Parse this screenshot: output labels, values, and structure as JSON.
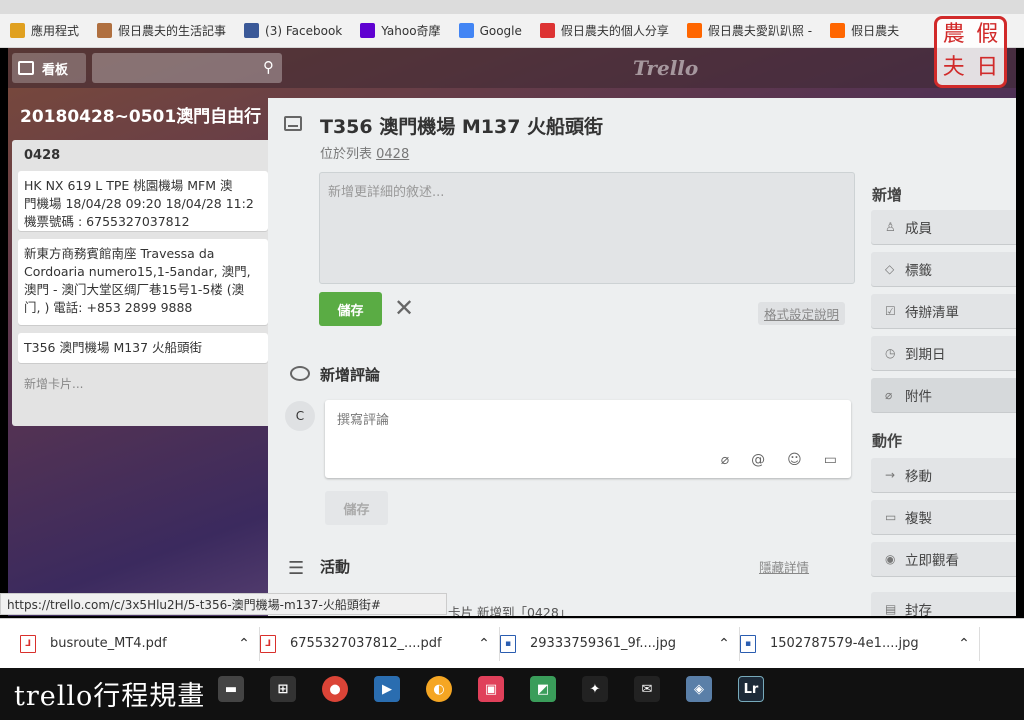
{
  "bookmarks": [
    {
      "label": "應用程式",
      "icon": "apps-grid-icon",
      "color": "#e0a020"
    },
    {
      "label": "假日農夫的生活記事",
      "icon": "farmer-avatar-icon",
      "color": "#b07040"
    },
    {
      "label": "(3) Facebook",
      "icon": "facebook-icon",
      "color": "#3b5998"
    },
    {
      "label": "Yahoo奇摩",
      "icon": "yahoo-icon",
      "color": "#5f01d1"
    },
    {
      "label": "Google",
      "icon": "google-icon",
      "color": "#4285f4"
    },
    {
      "label": "假日農夫的個人分享",
      "icon": "pin-icon",
      "color": "#d33"
    },
    {
      "label": "假日農夫愛趴趴照 - ",
      "icon": "blog-icon",
      "color": "#f60"
    },
    {
      "label": "假日農夫",
      "icon": "pixnet-icon",
      "color": "#f60"
    }
  ],
  "header": {
    "boards_label": "看板",
    "logo": "Trello"
  },
  "board": {
    "title": "20180428~0501澳門自由行"
  },
  "list": {
    "name": "0428",
    "cards": [
      "HK NX 619 L TPE 桃園機場 MFM 澳\n門機場 18/04/28 09:20 18/04/28 11:2\n機票號碼 : 6755327037812",
      "新東方商務賓館南座 Travessa da\nCordoaria numero15,1-5andar, 澳門,\n澳門 - 澳门大堂区绸厂巷15号1-5楼 (澳\n门, ) 電話: +853 2899 9888",
      "T356 澳門機場 M137 火船頭街"
    ],
    "add_card": "新增卡片..."
  },
  "card": {
    "title": "T356 澳門機場  M137 火船頭街",
    "in_list_prefix": "位於列表 ",
    "in_list_name": "0428",
    "desc_placeholder": "新增更詳細的敘述...",
    "save": "儲存",
    "close": "✕",
    "format_help": "格式設定說明",
    "comment_heading": "新增評論",
    "avatar_initial": "C",
    "comment_placeholder": "撰寫評論",
    "comment_save": "儲存",
    "activity_heading": "活動",
    "hide_details": "隱藏詳情",
    "activity_peek": "卡片 新增到「0428」"
  },
  "sidebar": {
    "add_heading": "新增",
    "add_items": [
      {
        "label": "成員",
        "icon": "member-icon"
      },
      {
        "label": "標籤",
        "icon": "label-icon"
      },
      {
        "label": "待辦清單",
        "icon": "checklist-icon"
      },
      {
        "label": "到期日",
        "icon": "clock-icon"
      },
      {
        "label": "附件",
        "icon": "attachment-icon"
      }
    ],
    "actions_heading": "動作",
    "action_items": [
      {
        "label": "移動",
        "icon": "arrow-right-icon"
      },
      {
        "label": "複製",
        "icon": "copy-icon"
      },
      {
        "label": "立即觀看",
        "icon": "eye-icon"
      },
      {
        "label": "封存",
        "icon": "archive-icon"
      }
    ]
  },
  "status_url": "https://trello.com/c/3x5Hlu2H/5-t356-澳門機場-m137-火船頭街#",
  "downloads": [
    {
      "name": "busroute_MT4.pdf",
      "type": "pdf"
    },
    {
      "name": "6755327037812_....pdf",
      "type": "pdf"
    },
    {
      "name": "29333759361_9f....jpg",
      "type": "img"
    },
    {
      "name": "1502787579-4e1....jpg",
      "type": "img"
    }
  ],
  "watermark": "trello行程規畫",
  "stamp": [
    "農",
    "假",
    "夫",
    "日"
  ]
}
